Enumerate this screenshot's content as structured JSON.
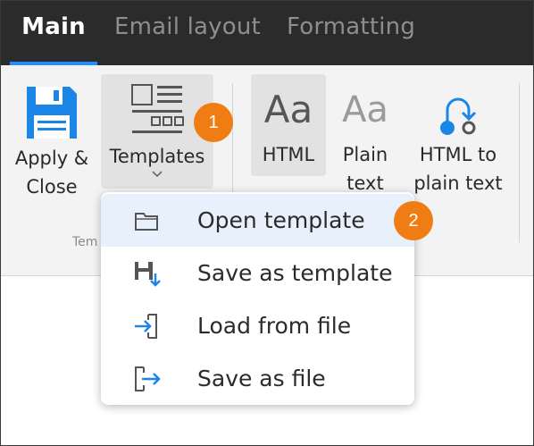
{
  "tabs": [
    {
      "label": "Main",
      "active": true
    },
    {
      "label": "Email layout",
      "active": false
    },
    {
      "label": "Formatting",
      "active": false
    }
  ],
  "ribbon": {
    "apply_close": {
      "line1": "Apply &",
      "line2": "Close",
      "icon": "floppy-disk-icon"
    },
    "templates": {
      "label": "Templates",
      "icon": "templates-icon",
      "highlighted": true
    },
    "group_label_partial": "Tem",
    "html": {
      "label": "HTML",
      "icon": "aa-bold-icon",
      "glyph": "Aa",
      "selected": true
    },
    "plain_text": {
      "line1": "Plain",
      "line2": "text",
      "icon": "aa-thin-icon",
      "glyph": "Aa"
    },
    "html_to_plain": {
      "line1": "HTML to",
      "line2": "plain text",
      "icon": "convert-arrow-icon"
    }
  },
  "callouts": [
    {
      "number": "1"
    },
    {
      "number": "2"
    }
  ],
  "menu": {
    "items": [
      {
        "label": "Open template",
        "icon": "folder-icon",
        "selected": true
      },
      {
        "label": "Save as template",
        "icon": "save-template-icon",
        "selected": false
      },
      {
        "label": "Load from file",
        "icon": "load-file-icon",
        "selected": false
      },
      {
        "label": "Save as file",
        "icon": "save-file-icon",
        "selected": false
      }
    ]
  },
  "colors": {
    "accent": "#1f8fff",
    "tabbar_bg": "#2b2b2b",
    "badge": "#f07d13",
    "menu_selected": "#e8f1fb",
    "icon_blue": "#1b86e8"
  }
}
